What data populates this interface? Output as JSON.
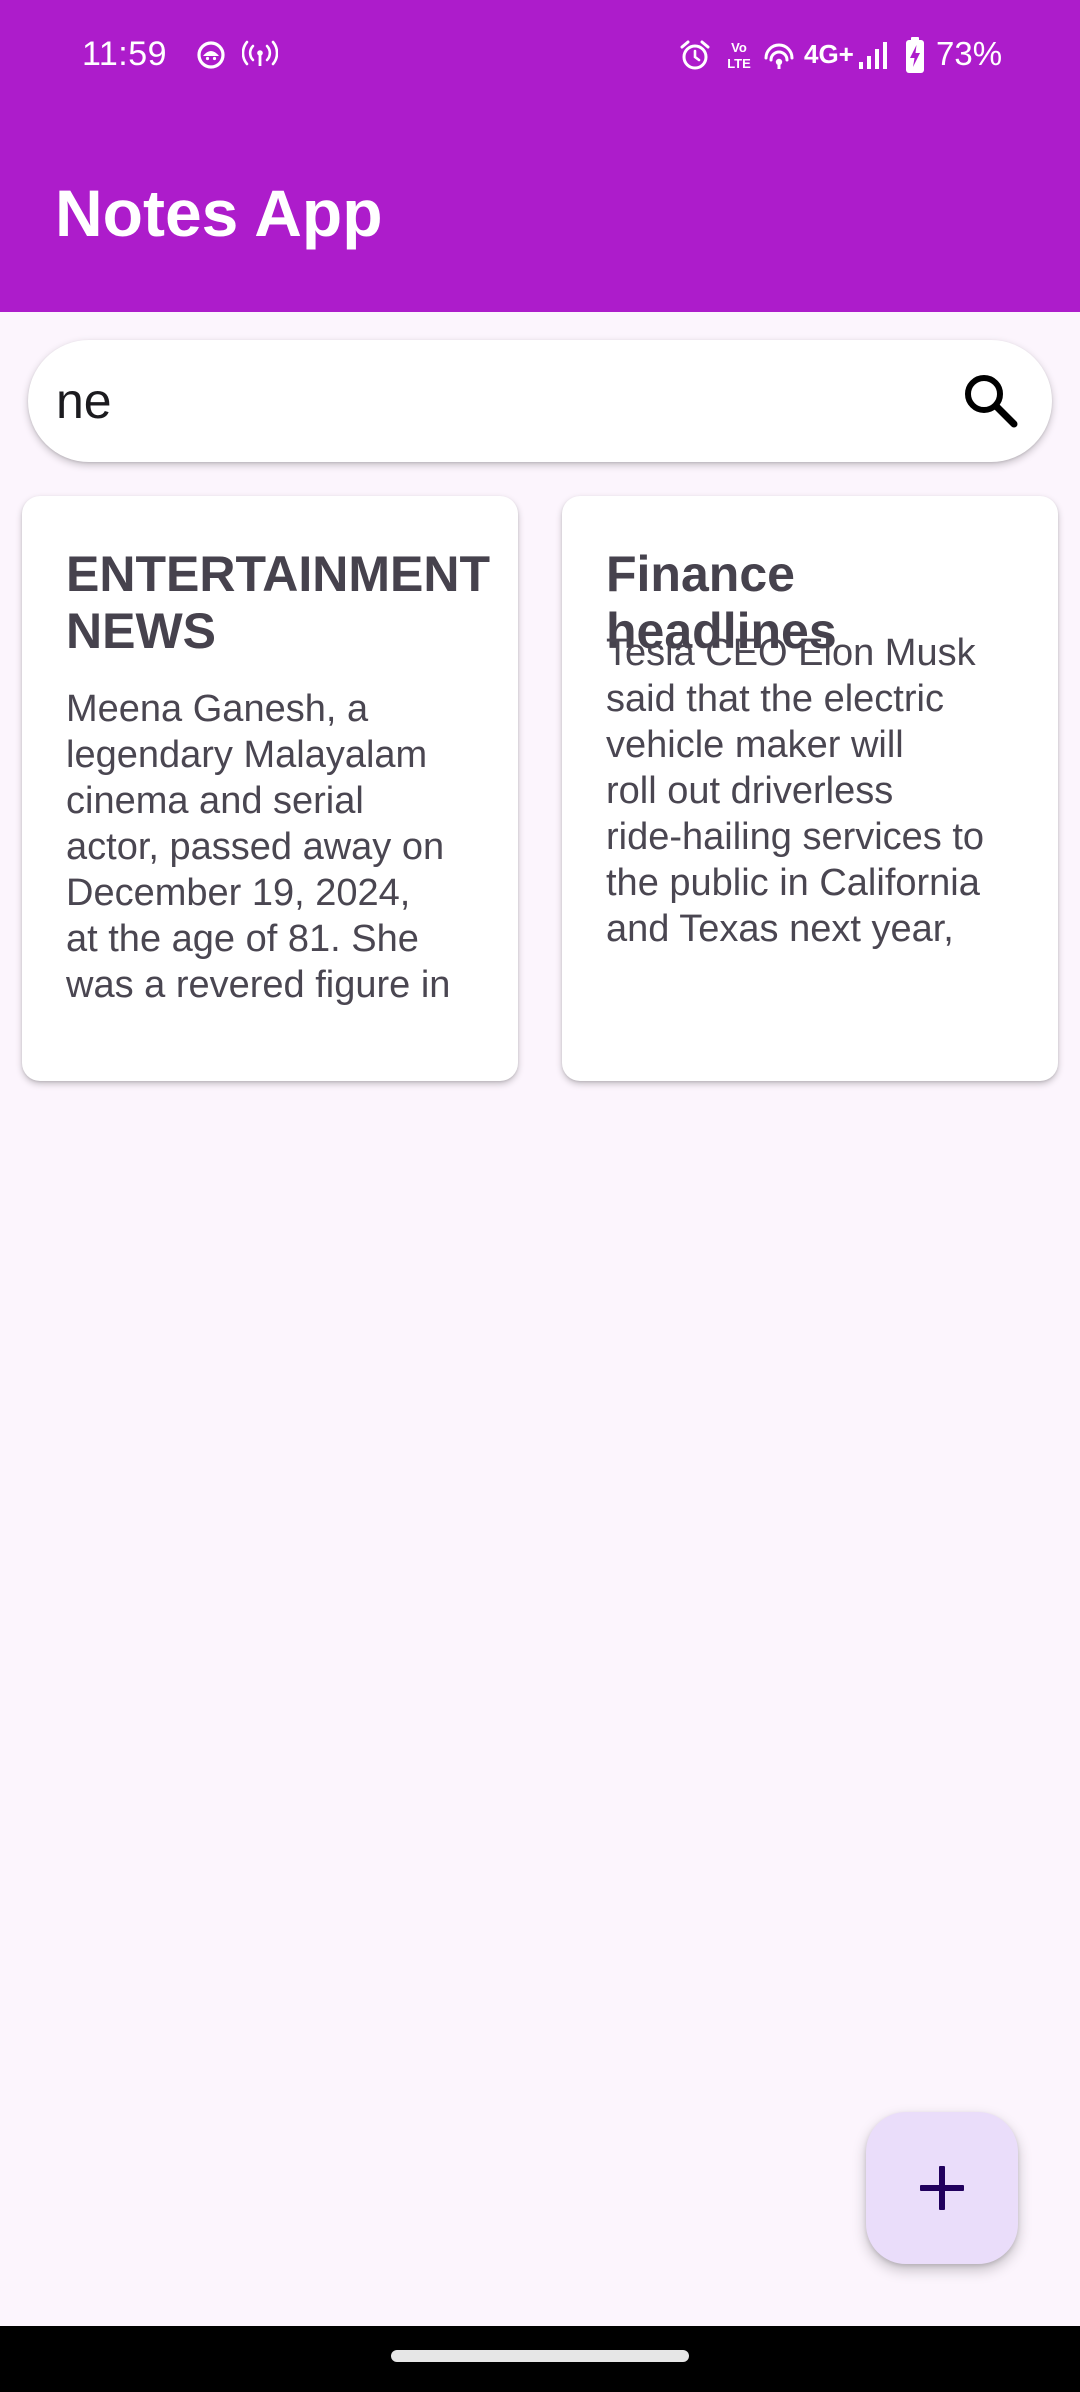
{
  "colors": {
    "app_bar": "#AD1CCB",
    "background": "#FCF5FD",
    "fab": "#EADDFA",
    "fab_icon": "#21005D",
    "card": "#FFFFFF",
    "card_text": "#46424D"
  },
  "status_bar": {
    "time": "11:59",
    "network": "4G+",
    "battery": "73%",
    "icons": [
      "android-notification-icon",
      "hotspot-icon",
      "alarm-icon",
      "volte-icon",
      "wifi-calling-icon",
      "signal-icon",
      "battery-charging-icon"
    ]
  },
  "app_bar": {
    "title": "Notes App"
  },
  "search": {
    "value": "ne",
    "icon": "search-icon"
  },
  "notes": [
    {
      "title": "ENTERTAINMENT NEWS",
      "body_lines": [
        "Meena Ganesh, a",
        "legendary Malayalam",
        "cinema and serial",
        "actor, passed away on",
        "December 19, 2024,",
        "at the age of 81. She",
        "was a revered figure in"
      ]
    },
    {
      "title": "Finance headlines",
      "body_lines": [
        "Tesla CEO Elon Musk",
        "said that the electric",
        "vehicle maker will",
        "roll out driverless",
        "ride-hailing services to",
        "the public in California",
        "and Texas next year,"
      ]
    }
  ],
  "fab": {
    "icon": "plus-icon"
  }
}
